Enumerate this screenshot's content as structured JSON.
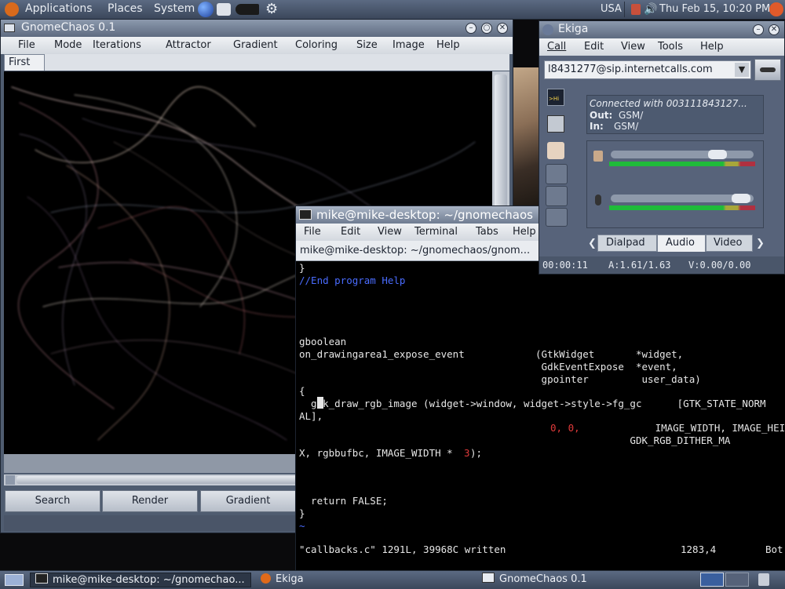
{
  "top_panel": {
    "menus": [
      "Applications",
      "Places",
      "System"
    ],
    "keyboard_layout": "USA",
    "clock": "Thu Feb 15, 10:20 PM"
  },
  "gnomechaos": {
    "title": "GnomeChaos 0.1",
    "menus": [
      "File",
      "Mode",
      "Iterations",
      "Attractor",
      "Gradient",
      "Coloring",
      "Size",
      "Image",
      "Help"
    ],
    "tab": "First",
    "buttons": [
      "Search",
      "Render",
      "Gradient"
    ]
  },
  "terminal": {
    "title": "mike@mike-desktop: ~/gnomechaos",
    "menus": [
      "File",
      "Edit",
      "View",
      "Terminal",
      "Tabs",
      "Help"
    ],
    "tab_title": "mike@mike-desktop: ~/gnomechaos/gnom...",
    "lines": [
      "}",
      "//End program Help",
      "gboolean",
      "on_drawingarea1_expose_event            (GtkWidget       *widget,",
      "                                         GdkEventExpose  *event,",
      "                                         gpointer         user_data)",
      "{",
      "  gdk_draw_rgb_image (widget->window, widget->style->fg_gc      [GTK_STATE_NORM",
      "AL],",
      "                      IMAGE_WIDTH, IMAGE_HEIGHT,",
      "                                                        GDK_RGB_DITHER_MA",
      "X, rgbbufbc, IMAGE_WIDTH * ",
      "  return FALSE;",
      "}",
      "~"
    ],
    "zero_literals": "0, 0, ",
    "three_literal": "3",
    "after_three": ");",
    "status_left": "\"callbacks.c\" 1291L, 39968C written",
    "status_pos": "1283,4",
    "status_right": "Bot"
  },
  "ekiga": {
    "title": "Ekiga",
    "menus": [
      "Call",
      "Edit",
      "View",
      "Tools",
      "Help"
    ],
    "address": "l8431277@sip.internetcalls.com",
    "connected_text": "Connected with 003111843127...",
    "out_label": "Out:",
    "out_value": "GSM/",
    "in_label": "In:",
    "in_value": "GSM/",
    "tabs": [
      "Dialpad",
      "Audio",
      "Video"
    ],
    "status_time": "00:00:11",
    "status_audio": "A:1.61/1.63",
    "status_video": "V:0.00/0.00",
    "hi_label": ">Hi"
  },
  "bottom_panel": {
    "tasks": [
      "mike@mike-desktop: ~/gnomechao...",
      "Ekiga",
      "GnomeChaos 0.1"
    ]
  },
  "colors": {
    "panel": "#4a566c",
    "keyword_blue": "#4a6cff",
    "literal_red": "#e03a3a",
    "term_text": "#e6e6e6"
  }
}
